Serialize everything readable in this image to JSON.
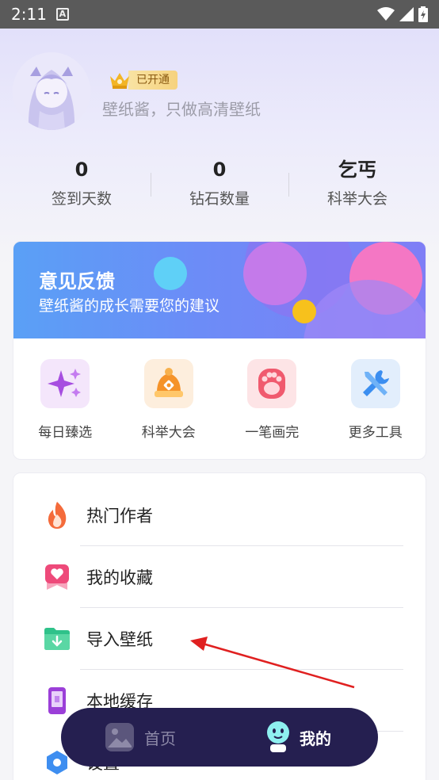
{
  "status_bar": {
    "time": "2:11",
    "notification_letter": "A"
  },
  "profile": {
    "vip_label": "已开通",
    "subtitle": "壁纸酱，只做高清壁纸"
  },
  "stats": [
    {
      "value": "0",
      "label": "签到天数"
    },
    {
      "value": "0",
      "label": "钻石数量"
    },
    {
      "value": "乞丐",
      "label": "科举大会"
    }
  ],
  "banner": {
    "title": "意见反馈",
    "subtitle": "壁纸酱的成长需要您的建议"
  },
  "tools": [
    {
      "label": "每日臻选",
      "icon": "sparkle-icon"
    },
    {
      "label": "科举大会",
      "icon": "exam-icon"
    },
    {
      "label": "一笔画完",
      "icon": "paw-icon"
    },
    {
      "label": "更多工具",
      "icon": "tools-icon"
    }
  ],
  "menu": [
    {
      "label": "热门作者",
      "icon": "flame-icon"
    },
    {
      "label": "我的收藏",
      "icon": "heart-bookmark-icon"
    },
    {
      "label": "导入壁纸",
      "icon": "folder-download-icon"
    },
    {
      "label": "本地缓存",
      "icon": "phone-icon"
    },
    {
      "label": "设置",
      "icon": "settings-icon"
    }
  ],
  "bottom_nav": {
    "home_label": "首页",
    "me_label": "我的"
  },
  "colors": {
    "arrow": "#e02020",
    "nav_bg": "#251f50",
    "vip_gold": "#f6d27e"
  }
}
